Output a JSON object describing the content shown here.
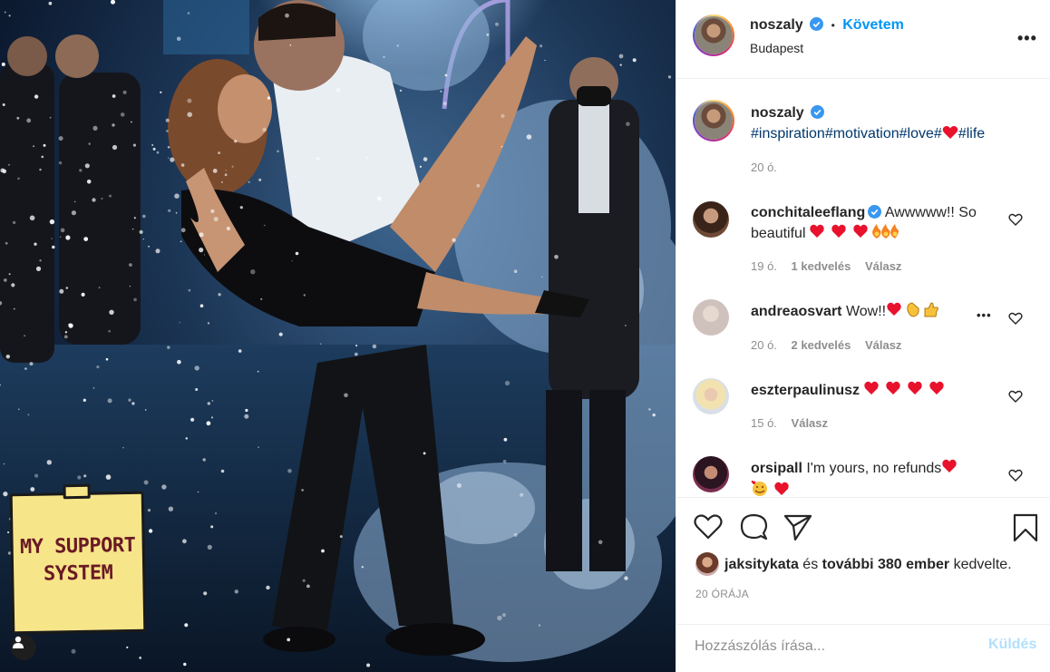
{
  "post": {
    "author": "noszaly",
    "follow_label": "Követem",
    "dot": "•",
    "location": "Budapest",
    "more": "•••"
  },
  "caption": {
    "author": "noszaly",
    "hashtags": [
      "#inspiration",
      "#motivation",
      "#love",
      "#",
      "#life"
    ],
    "time": "20 ó."
  },
  "sticker": {
    "line1": "MY SUPPORT",
    "line2": "SYSTEM"
  },
  "comments": [
    {
      "user": "conchitaleeflang",
      "verified": true,
      "text": "Awwwww!! So beautiful",
      "emojis": "❤️❤️❤️🔥🔥🔥",
      "time": "19 ó.",
      "likes": "1 kedvelés",
      "reply": "Válasz"
    },
    {
      "user": "andreaosvart",
      "verified": false,
      "text": "Wow!!",
      "emojis": "❤️👏👍",
      "time": "20 ó.",
      "likes": "2 kedvelés",
      "reply": "Válasz"
    },
    {
      "user": "eszterpaulinusz",
      "verified": false,
      "text": "",
      "emojis": "❤️❤️❤️❤️",
      "time": "15 ó.",
      "likes": "",
      "reply": "Válasz"
    },
    {
      "user": "orsipall",
      "verified": false,
      "text": "I'm yours, no refunds",
      "emojis": "❤️🥰❤️",
      "time": "",
      "likes": "",
      "reply": ""
    }
  ],
  "actions": {
    "liked_by_user": "jaksitykata",
    "liked_by_and": "és",
    "liked_by_others": "további 380 ember",
    "liked_by_suffix": "kedvelte.",
    "date": "20 ÓRÁJA"
  },
  "comment_box": {
    "placeholder": "Hozzászólás írása...",
    "send_label": "Küldés"
  },
  "colors": {
    "link": "#0095f6",
    "hashtag": "#00376b",
    "muted": "#8e8e8e",
    "heart": "#e8122d"
  }
}
